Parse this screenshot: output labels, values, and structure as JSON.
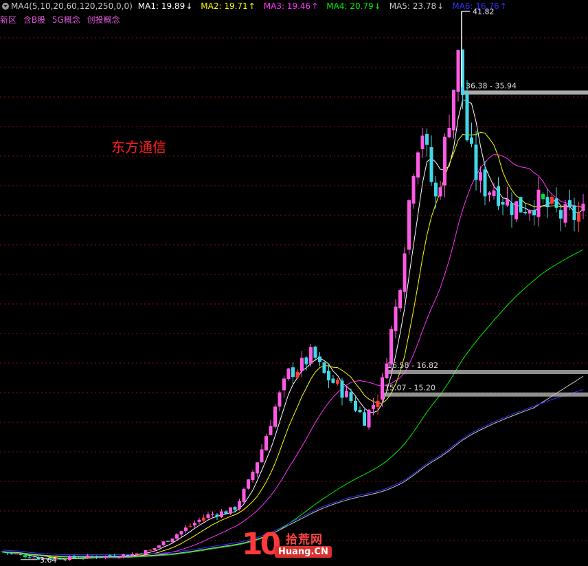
{
  "header": {
    "indicator": "MA4(5,10,20,60,120,250,0,0)",
    "indicator_icon": "gear-icon",
    "ma": [
      {
        "label": "MA1: 19.89",
        "color": "#ffffff",
        "dir": "down"
      },
      {
        "label": "MA2: 19.71",
        "color": "#ffff00",
        "dir": "up"
      },
      {
        "label": "MA3: 19.46",
        "color": "#ff33ff",
        "dir": "up"
      },
      {
        "label": "MA4: 20.79",
        "color": "#00ee00",
        "dir": "down"
      },
      {
        "label": "MA5: 23.78",
        "color": "#c8c8c8",
        "dir": "down"
      },
      {
        "label": "MA6: 16.76",
        "color": "#3333ff",
        "dir": "up"
      }
    ]
  },
  "tags": [
    "新区",
    "含B股",
    "5G概念",
    "创投概念"
  ],
  "stock_name": "东方通信",
  "watermark": {
    "number": "10",
    "cn": "拾荒网",
    "site": "Huang.CN"
  },
  "chart_data": {
    "type": "candlestick",
    "ylim": [
      3.2,
      42.6
    ],
    "high_label": "41.82",
    "low_label": "3.64",
    "zones": [
      {
        "label": "36.38 - 35.94",
        "low": 35.94,
        "high": 36.38
      },
      {
        "label": "16.58 - 16.82",
        "low": 16.58,
        "high": 16.82
      },
      {
        "label": "15.07 - 15.20",
        "low": 15.07,
        "high": 15.2
      }
    ],
    "colors": {
      "up": "#ff5ae6",
      "down": "#40d8e8",
      "up_alt": "#ff3a3a",
      "down_alt": "#00dd44",
      "grid": "#8a1010"
    },
    "ma_colors": [
      "#ffffff",
      "#ffff00",
      "#ff33ff",
      "#00ee00",
      "#c8c8c8",
      "#3333ff"
    ]
  }
}
